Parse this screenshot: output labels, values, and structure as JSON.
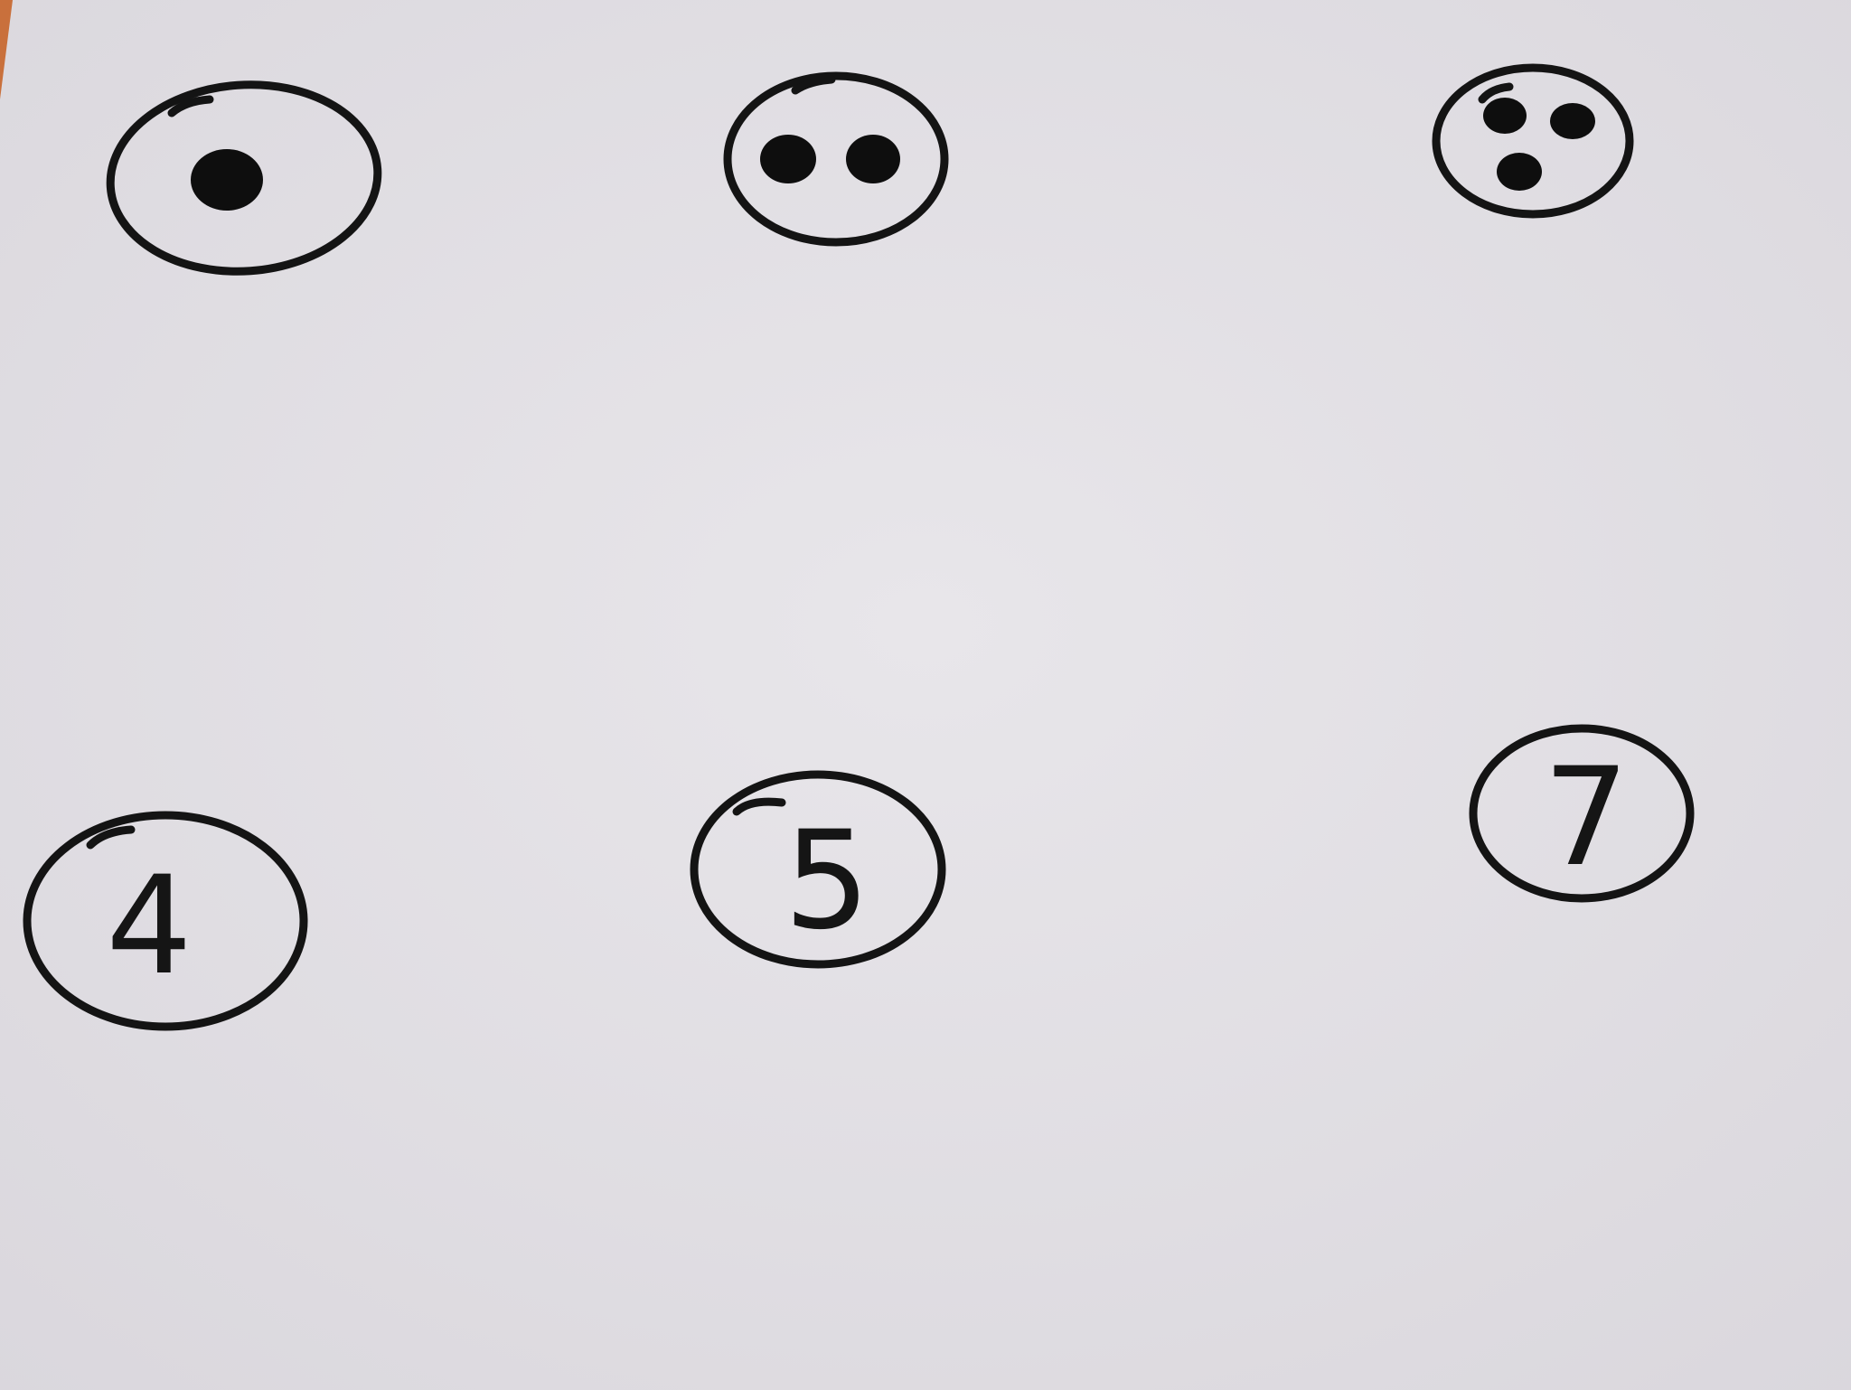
{
  "drawing": {
    "paper_color": "#e3e1e6",
    "ink_color": "#141414",
    "table_color": "#c9703c",
    "top_row": [
      {
        "dot_count": 1
      },
      {
        "dot_count": 2
      },
      {
        "dot_count": 3
      }
    ],
    "bottom_row": [
      {
        "label": "4"
      },
      {
        "label": "5"
      },
      {
        "label": "7"
      }
    ]
  }
}
